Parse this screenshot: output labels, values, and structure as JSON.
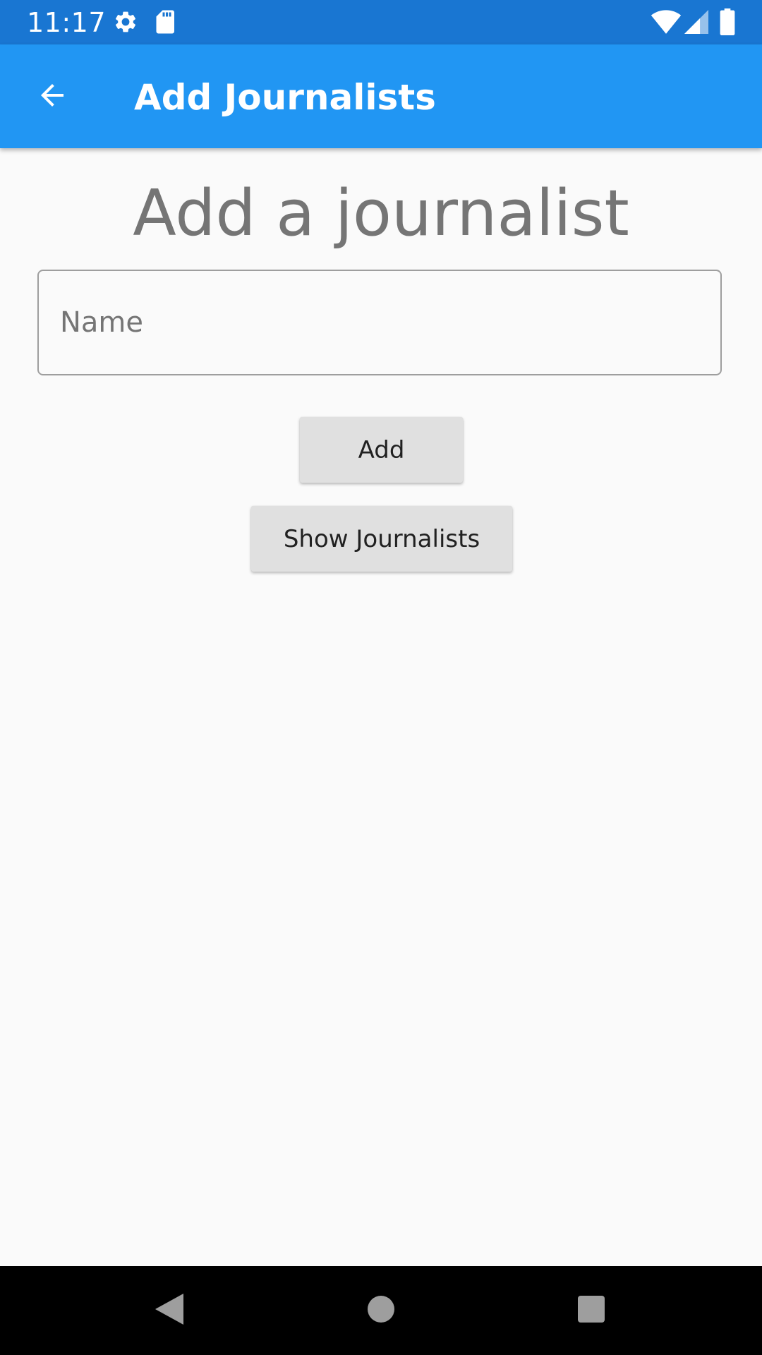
{
  "status_bar": {
    "time": "11:17",
    "left_icons": [
      "gear-icon",
      "sd-card-icon"
    ],
    "right_icons": [
      "wifi-icon",
      "cell-signal-icon",
      "battery-icon"
    ]
  },
  "app_bar": {
    "title": "Add Journalists",
    "back_icon": "arrow-back-icon"
  },
  "main": {
    "heading": "Add a journalist",
    "name_field": {
      "placeholder": "Name",
      "value": ""
    },
    "add_button": "Add",
    "show_button": "Show Journalists"
  },
  "nav_bar": {
    "icons": [
      "nav-back-icon",
      "nav-home-icon",
      "nav-recents-icon"
    ]
  },
  "colors": {
    "status_bar": "#1976d2",
    "app_bar": "#2196f3",
    "background": "#fafafa",
    "heading_text": "#757575",
    "button_bg": "#e0e0e0",
    "nav_bar": "#000000"
  }
}
